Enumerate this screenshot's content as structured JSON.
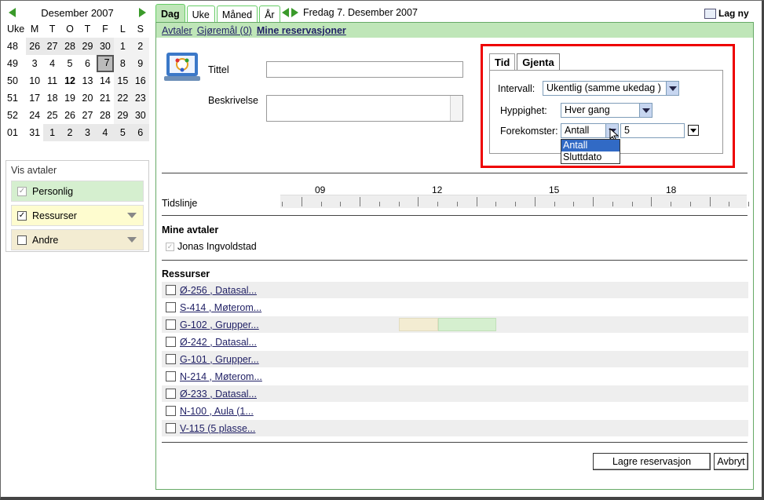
{
  "calendar": {
    "month_title": "Desember 2007",
    "day_headers": [
      "Uke",
      "M",
      "T",
      "O",
      "T",
      "F",
      "L",
      "S"
    ],
    "rows": [
      {
        "week": "48",
        "days": [
          "26",
          "27",
          "28",
          "29",
          "30",
          "1",
          "2"
        ]
      },
      {
        "week": "49",
        "days": [
          "3",
          "4",
          "5",
          "6",
          "7",
          "8",
          "9"
        ]
      },
      {
        "week": "50",
        "days": [
          "10",
          "11",
          "12",
          "13",
          "14",
          "15",
          "16"
        ]
      },
      {
        "week": "51",
        "days": [
          "17",
          "18",
          "19",
          "20",
          "21",
          "22",
          "23"
        ]
      },
      {
        "week": "52",
        "days": [
          "24",
          "25",
          "26",
          "27",
          "28",
          "29",
          "30"
        ]
      },
      {
        "week": "01",
        "days": [
          "31",
          "1",
          "2",
          "3",
          "4",
          "5",
          "6"
        ]
      }
    ]
  },
  "vis_avtaler": {
    "title": "Vis avtaler",
    "items": [
      {
        "label": "Personlig",
        "color": "#d5efcf"
      },
      {
        "label": "Ressurser",
        "color": "#fefccf"
      },
      {
        "label": "Andre",
        "color": "#f3ecd2"
      }
    ]
  },
  "tabs": [
    "Dag",
    "Uke",
    "Måned",
    "År"
  ],
  "date_label": "Fredag 7. Desember 2007",
  "new_label": "Lag ny",
  "subnav": [
    "Avtaler",
    "Gjøremål (0)",
    "Mine reservasjoner"
  ],
  "form": {
    "title_label": "Tittel",
    "desc_label": "Beskrivelse"
  },
  "repeat": {
    "tabs": [
      "Tid",
      "Gjenta"
    ],
    "interval_label": "Intervall:",
    "interval_value": "Ukentlig (samme ukedag )",
    "freq_label": "Hyppighet:",
    "freq_value": "Hver gang",
    "occ_label": "Forekomster:",
    "occ_value": "Antall",
    "occ_count": "5",
    "options": [
      "Antall",
      "Sluttdato"
    ]
  },
  "timeline": {
    "label": "Tidslinje",
    "hours": [
      "09",
      "12",
      "15",
      "18"
    ]
  },
  "mine": {
    "title": "Mine avtaler",
    "person": "Jonas Ingvoldstad"
  },
  "resources": {
    "title": "Ressurser",
    "items": [
      "Ø-256 , Datasal...",
      "S-414 , Møterom...",
      "G-102 , Grupper...",
      "Ø-242 , Datasal...",
      "G-101 , Grupper...",
      "N-214 , Møterom...",
      "Ø-233 , Datasal...",
      "N-100 , Aula (1...",
      "V-115 (5 plasse..."
    ]
  },
  "buttons": {
    "save": "Lagre reservasjon",
    "cancel": "Avbryt"
  }
}
